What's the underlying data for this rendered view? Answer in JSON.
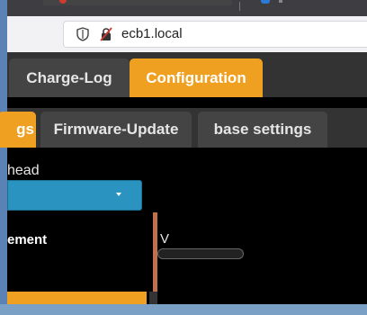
{
  "browser": {
    "url": "ecb1.local",
    "icons": [
      "shield-icon",
      "insecure-lock-icon"
    ]
  },
  "tabs": {
    "main": [
      {
        "label": "Charge-Log",
        "active": false
      },
      {
        "label": "Configuration",
        "active": true
      }
    ],
    "sub": [
      {
        "label": "gs",
        "active": true
      },
      {
        "label": "Firmware-Update",
        "active": false
      },
      {
        "label": "base settings",
        "active": false
      }
    ]
  },
  "form": {
    "field_label": "head",
    "select_value": "",
    "dropdown_item": "ement",
    "unit_text": "V"
  },
  "colors": {
    "accent": "#f0a020",
    "select": "#2a93bf",
    "tab_inactive": "#444444",
    "page_bg": "#000000"
  }
}
